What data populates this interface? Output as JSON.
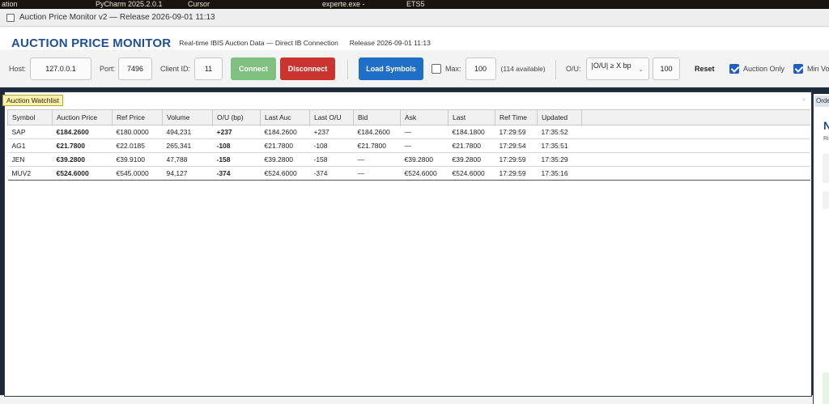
{
  "taskbar": {
    "items": [
      "ation",
      "PyCharm 2025.2.0.1",
      "Cursor",
      "experte.exe -",
      "ETS5"
    ]
  },
  "window": {
    "title": "Auction Price Monitor v2 — Release 2026-09-01 11:13"
  },
  "header": {
    "title": "AUCTION PRICE MONITOR",
    "subtitle": "Real-time IBIS Auction Data — Direct IB Connection",
    "release": "Release 2026-09-01 11:13"
  },
  "toolbar": {
    "host_label": "Host:",
    "host_value": "127.0.0.1",
    "port_label": "Port:",
    "port_value": "7496",
    "client_label": "Client ID:",
    "client_value": "11",
    "connect_label": "Connect",
    "disconnect_label": "Disconnect",
    "load_label": "Load Symbols",
    "max_label": "Max:",
    "max_value": "100",
    "available": "(114 available)",
    "ou_label": "O/U:",
    "ou_select": "|O/U| ≥ X bp",
    "ou_value": "100",
    "reset_label": "Reset",
    "auction_only_label": "Auction Only",
    "min_vol_label": "Min Vo"
  },
  "watchlist": {
    "tab": "Auction Watchlist",
    "menu_icon": "▾",
    "columns": [
      "Symbol",
      "Auction Price",
      "Ref Price",
      "Volume",
      "O/U (bp)",
      "Last Auc",
      "Last O/U",
      "Bid",
      "Ask",
      "Last",
      "Ref Time",
      "Updated"
    ],
    "rows": [
      {
        "symbol": "SAP",
        "auction": "€184.2600",
        "ref": "€180.0000",
        "volume": "494,231",
        "ou": "+237",
        "last_auc": "€184.2600",
        "last_ou": "+237",
        "bid": "€184.2600",
        "ask": "—",
        "last": "€184.1800",
        "ref_time": "17:29:59",
        "updated": "17:35:52",
        "dir": "pos",
        "bid_dir": "pos",
        "ask_dir": "neg"
      },
      {
        "symbol": "AG1",
        "auction": "€21.7800",
        "ref": "€22.0185",
        "volume": "265,341",
        "ou": "-108",
        "last_auc": "€21.7800",
        "last_ou": "-108",
        "bid": "€21.7800",
        "ask": "—",
        "last": "€21.7800",
        "ref_time": "17:29:54",
        "updated": "17:35:51",
        "dir": "neg",
        "bid_dir": "pos",
        "ask_dir": "neg"
      },
      {
        "symbol": "JEN",
        "auction": "€39.2800",
        "ref": "€39.9100",
        "volume": "47,788",
        "ou": "-158",
        "last_auc": "€39.2800",
        "last_ou": "-158",
        "bid": "—",
        "ask": "€39.2800",
        "last": "€39.2800",
        "ref_time": "17:29:59",
        "updated": "17:35:29",
        "dir": "neg",
        "bid_dir": "pos",
        "ask_dir": "neg"
      },
      {
        "symbol": "MUV2",
        "auction": "€524.6000",
        "ref": "€545.0000",
        "volume": "94,127",
        "ou": "-374",
        "last_auc": "€524.6000",
        "last_ou": "-374",
        "bid": "—",
        "ask": "€524.6000",
        "last": "€524.6000",
        "ref_time": "17:29:59",
        "updated": "17:35:16",
        "dir": "neg",
        "bid_dir": "pos",
        "ask_dir": "neg"
      }
    ]
  },
  "side_panel": {
    "tab": "Orde",
    "big_letter": "N",
    "small_text": "Ri"
  },
  "colors": {
    "brand": "#1f4e9c",
    "connect": "#7fbf7f",
    "disconnect": "#c9342f",
    "load": "#1f6fc9",
    "positive": "#1c7a2c",
    "negative": "#b02020",
    "auction_price": "#8a6a00"
  }
}
